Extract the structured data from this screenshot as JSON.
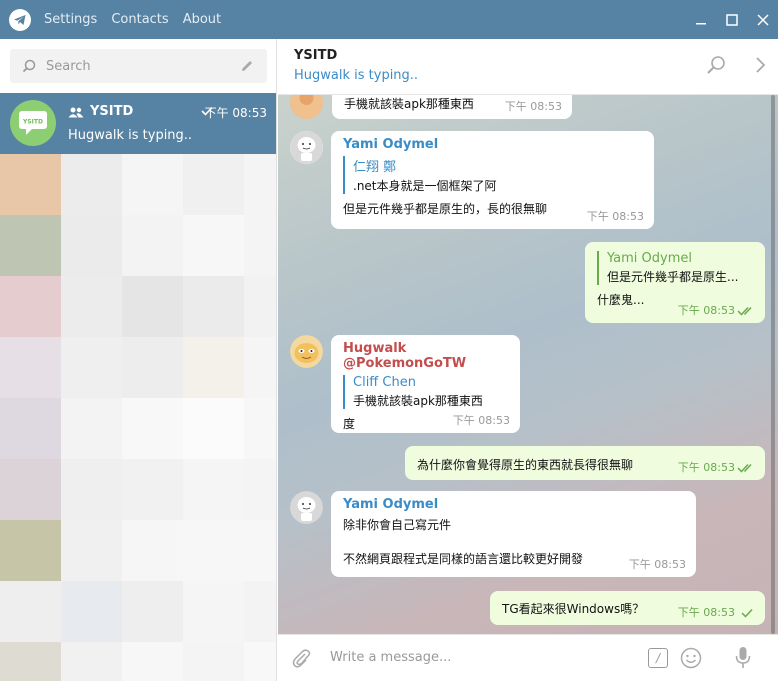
{
  "menu": {
    "settings": "Settings",
    "contacts": "Contacts",
    "about": "About"
  },
  "sidebar": {
    "search_placeholder": "Search",
    "chat": {
      "avatar_text": "YSITD",
      "name": "YSITD",
      "time": "下午 08:53",
      "preview": "Hugwalk is typing.."
    },
    "mosaic_colors": [
      "#e8c7a9",
      "#ececec",
      "#f5f5f5",
      "#f0f0f0",
      "#f4f4f4",
      "#bfc5b3",
      "#ebebeb",
      "#f3f3f3",
      "#f7f7f7",
      "#f4f4f4",
      "#e5cdcf",
      "#ececec",
      "#e5e5e5",
      "#ebebeb",
      "#f2f2f2",
      "#e6dfe6",
      "#efefef",
      "#ededed",
      "#f4f1ea",
      "#f5f5f5",
      "#ded9e0",
      "#f3f3f3",
      "#f8f8f8",
      "#fbfbfb",
      "#f7f7f7",
      "#dcd3d9",
      "#efefef",
      "#f1f1f1",
      "#f5f5f5",
      "#f4f4f4",
      "#c6c5a8",
      "#f0f0f0",
      "#f6f6f6",
      "#f7f7f7",
      "#f7f7f7",
      "#eeeeef",
      "#e7ebf0",
      "#eeeeee",
      "#f5f5f5",
      "#f3f3f3",
      "#dedbd2",
      "#f1f1f1",
      "#f7f7f7",
      "#f4f4f4",
      "#f8f8f8"
    ]
  },
  "header": {
    "title": "YSITD",
    "status": "Hugwalk is typing.."
  },
  "messages": [
    {
      "text": "手機就該裝apk那種東西",
      "time": "下午 08:53"
    },
    {
      "author": "Yami Odymel",
      "quote_name": "仁翔 鄭",
      "quote_text": ".net本身就是一個框架了阿",
      "text": "但是元件幾乎都是原生的，長的很無聊",
      "time": "下午 08:53"
    },
    {
      "quote_name": "Yami Odymel",
      "quote_text": "但是元件幾乎都是原生...",
      "text": "什麼鬼...",
      "time": "下午 08:53"
    },
    {
      "author": "Hugwalk @PokemonGoTW",
      "quote_name": "Cliff Chen",
      "quote_text": "手機就該裝apk那種東西",
      "text": "度",
      "time": "下午 08:53"
    },
    {
      "text": "為什麼你會覺得原生的東西就長得很無聊",
      "time": "下午 08:53"
    },
    {
      "author": "Yami Odymel",
      "line1": "除非你會自己寫元件",
      "line2": "不然網頁跟程式是同樣的語言還比較更好開發",
      "time": "下午 08:53"
    },
    {
      "text": "TG看起來很Windows嗎？",
      "time": "下午 08:53"
    }
  ],
  "composer": {
    "placeholder": "Write a message..."
  }
}
